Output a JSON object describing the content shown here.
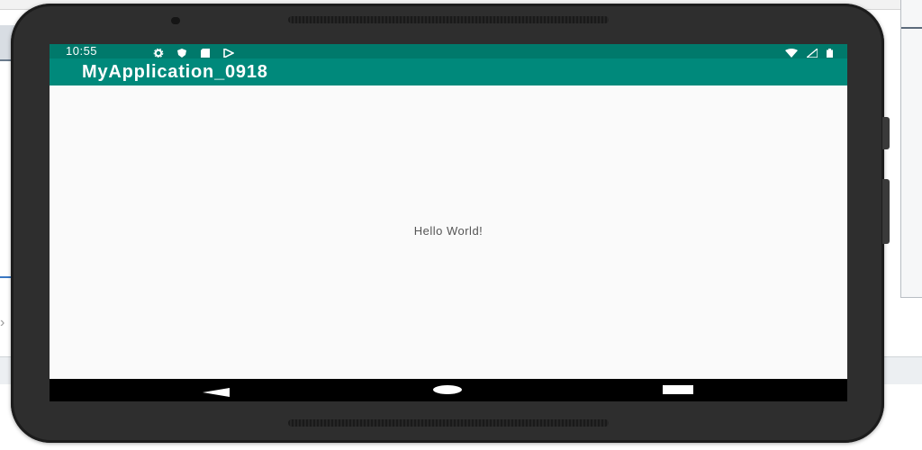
{
  "status_bar": {
    "time": "10:55",
    "left_icons": [
      "settings-icon",
      "shield-icon",
      "sd-card-icon",
      "play-store-icon"
    ],
    "right_icons": [
      "wifi-icon",
      "signal-icon",
      "battery-icon"
    ]
  },
  "app_bar": {
    "title": "MyApplication_0918"
  },
  "content": {
    "text": "Hello World!"
  },
  "nav_bar": {
    "buttons": [
      "back-icon",
      "home-icon",
      "recents-icon"
    ]
  },
  "colors": {
    "status_bar": "#00796b",
    "app_bar": "#00897b",
    "screen_bg": "#fafafa",
    "device_body": "#2e2e2e"
  }
}
